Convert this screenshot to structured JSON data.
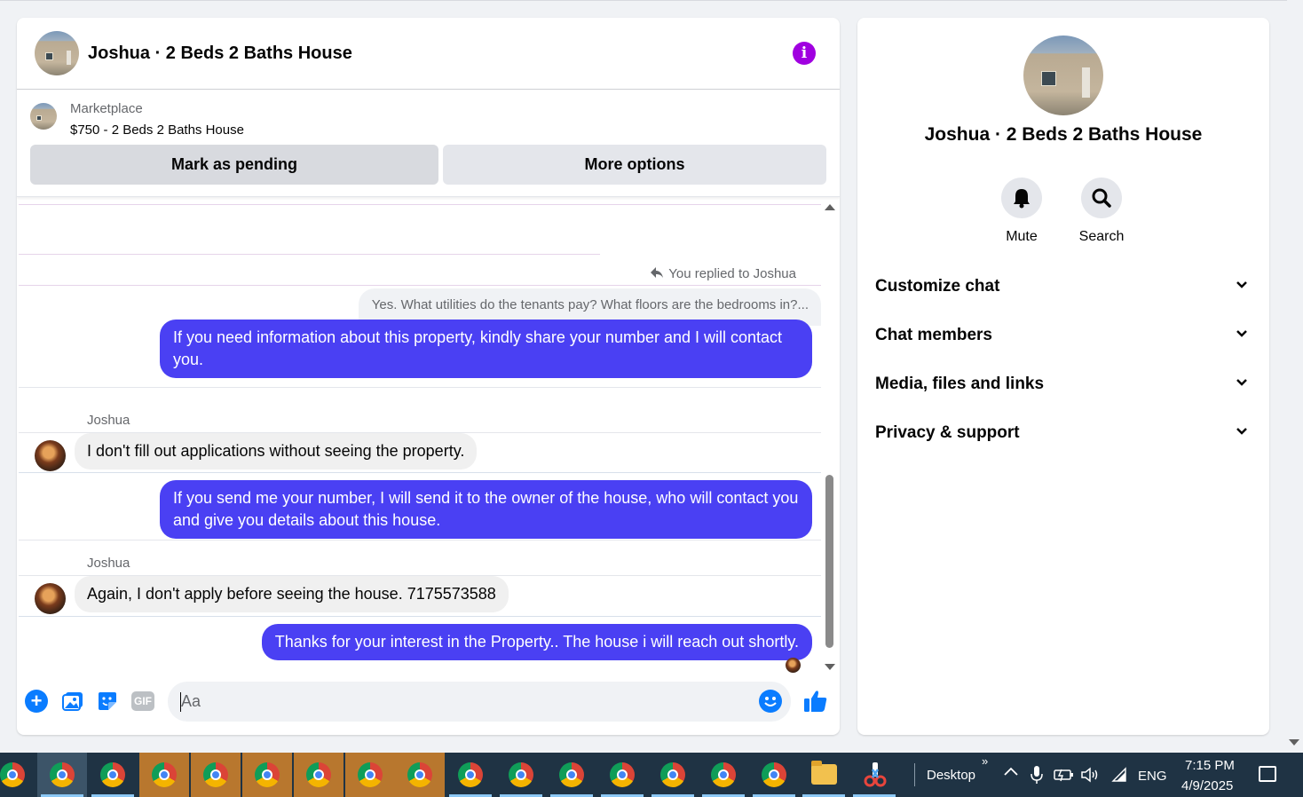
{
  "header": {
    "title": "Joshua · 2 Beds 2 Baths House"
  },
  "marketplace": {
    "label": "Marketplace",
    "listing": "$750 - 2 Beds 2 Baths House",
    "mark_pending_label": "Mark as pending",
    "more_options_label": "More options"
  },
  "messages": {
    "replied_label": "You replied to Joshua",
    "quoted_text": "Yes. What utilities do the tenants pay? What floors are the bedrooms in?...",
    "msg1": "If you need information about this property, kindly share  your number and I will contact you.",
    "sender1": "Joshua",
    "msg2": "I don't fill out applications without seeing the property.",
    "msg3": "If you send me your number, I will send it to the owner of the house, who will contact you and give you details about this house.",
    "sender2": "Joshua",
    "msg4": "Again, I don't apply before seeing the house. 7175573588",
    "msg5": "Thanks for your interest in the Property.. The house i will reach  out shortly."
  },
  "composer": {
    "placeholder": "Aa",
    "gif_label": "GIF"
  },
  "side": {
    "title": "Joshua · 2 Beds 2 Baths House",
    "mute_label": "Mute",
    "search_label": "Search",
    "sections": [
      "Customize chat",
      "Chat members",
      "Media, files and links",
      "Privacy & support"
    ]
  },
  "taskbar": {
    "desktop_label": "Desktop",
    "lang": "ENG",
    "time": "7:15 PM",
    "date": "4/9/2025"
  },
  "colors": {
    "outgoing_bubble": "#4a40f3",
    "incoming_bubble": "#f0f0f0",
    "info_icon": "#a000e0",
    "messenger_blue": "#0a7cff",
    "taskbar": "#1f3344"
  }
}
